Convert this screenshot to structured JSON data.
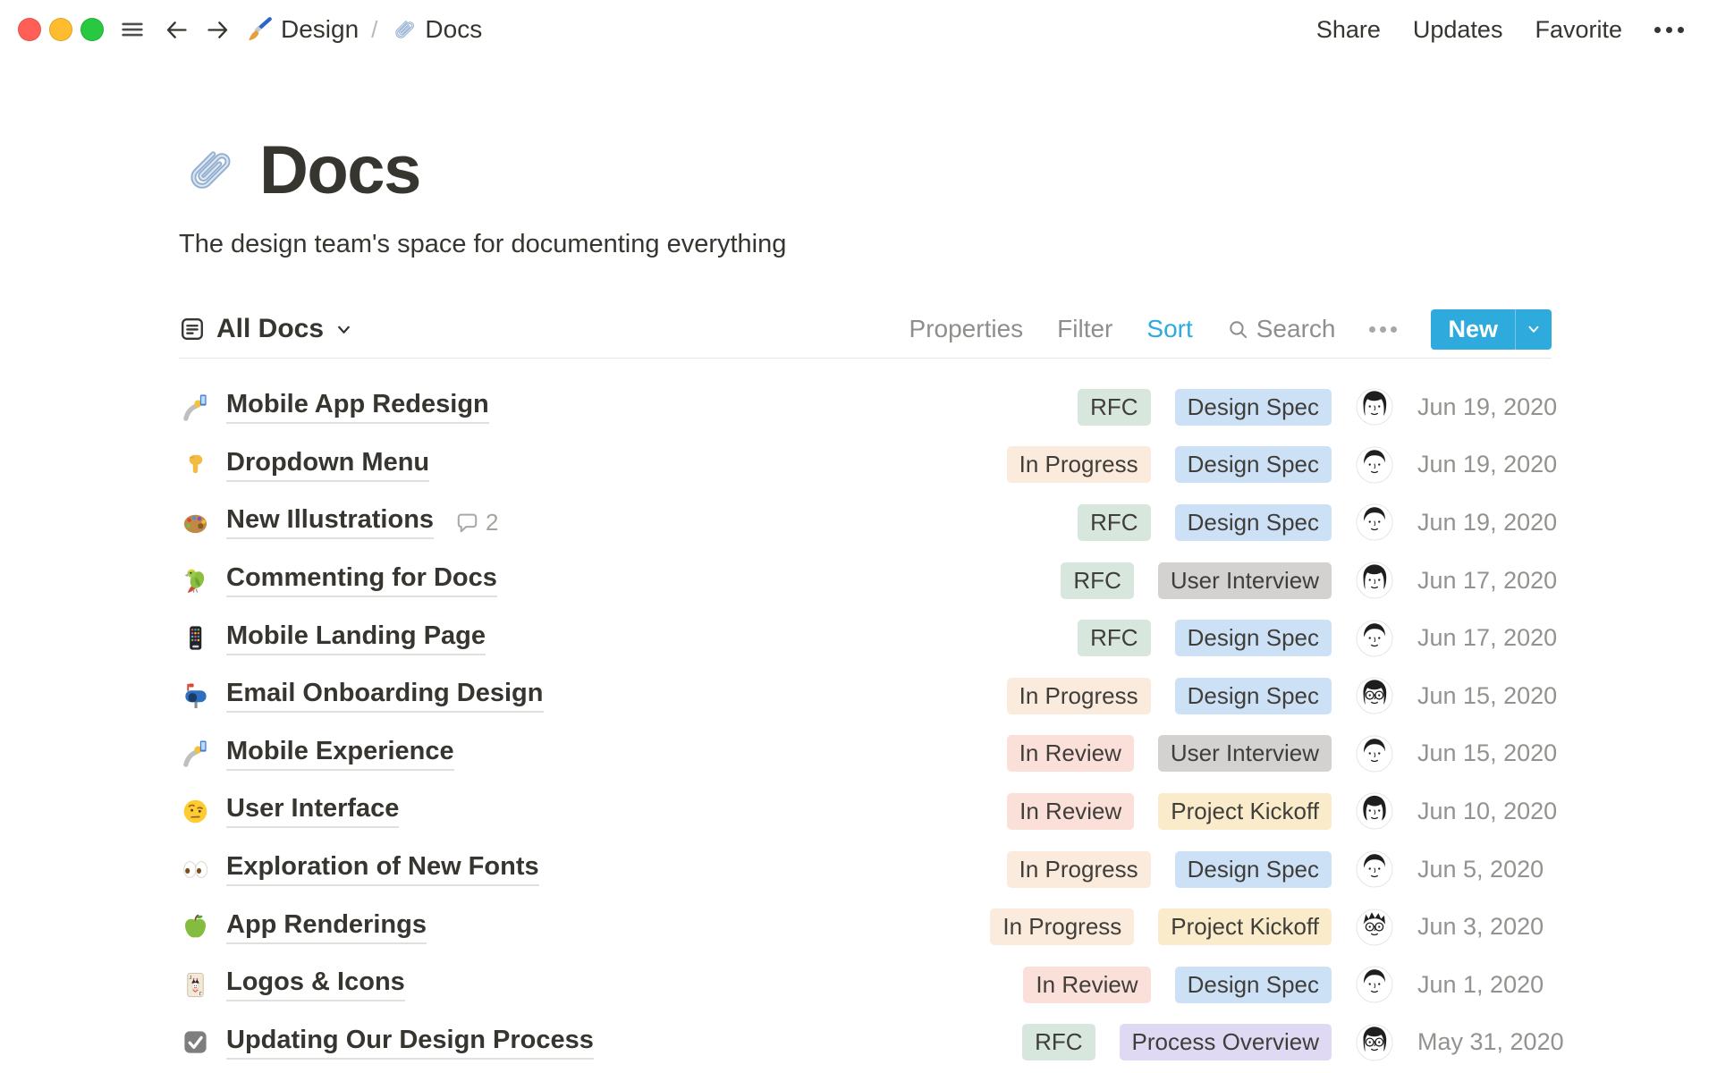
{
  "topbar": {
    "window_buttons": [
      "close",
      "minimize",
      "zoom"
    ],
    "breadcrumb": [
      {
        "icon": "paintbrush-icon",
        "label": "Design"
      },
      {
        "icon": "paperclip-icon",
        "label": "Docs"
      }
    ],
    "separator": "/",
    "actions": [
      "Share",
      "Updates",
      "Favorite"
    ],
    "more_icon": "ellipsis-icon"
  },
  "page": {
    "icon": "paperclip-icon",
    "title": "Docs",
    "subtitle": "The design team's space for documenting everything"
  },
  "toolbar": {
    "view_icon": "list-view-icon",
    "view_label": "All Docs",
    "properties_label": "Properties",
    "filter_label": "Filter",
    "sort_label": "Sort",
    "search_icon": "search-icon",
    "search_label": "Search",
    "more_icon": "ellipsis-icon",
    "new_label": "New",
    "new_chevron_icon": "chevron-down-icon"
  },
  "colors": {
    "accent": "#2EAADC",
    "sort_active": "#2EAADC",
    "traffic": {
      "close": "#FF5F57",
      "minimize": "#FEBC2E",
      "zoom": "#28C840"
    },
    "badge_text": "#403E3A",
    "badges": {
      "green": "#D7E7DD",
      "orange": "#FAEBDC",
      "red": "#FBE0DA",
      "blue": "#CDE1F6",
      "gray": "#D3D2D0",
      "yellow": "#FAECCA",
      "purple": "#E0D9F4"
    }
  },
  "table": {
    "rows": [
      {
        "icon": "selfie",
        "title": "Mobile App Redesign",
        "status": "RFC",
        "status_color": "green",
        "type": "Design Spec",
        "type_color": "blue",
        "avatar": "woman",
        "date": "Jun 19, 2020"
      },
      {
        "icon": "point-down",
        "title": "Dropdown Menu",
        "status": "In Progress",
        "status_color": "orange",
        "type": "Design Spec",
        "type_color": "blue",
        "avatar": "man",
        "date": "Jun 19, 2020"
      },
      {
        "icon": "palette",
        "title": "New Illustrations",
        "comments": "2",
        "status": "RFC",
        "status_color": "green",
        "type": "Design Spec",
        "type_color": "blue",
        "avatar": "man",
        "date": "Jun 19, 2020"
      },
      {
        "icon": "parrot",
        "title": "Commenting for Docs",
        "status": "RFC",
        "status_color": "green",
        "type": "User Interview",
        "type_color": "gray",
        "avatar": "woman",
        "date": "Jun 17, 2020"
      },
      {
        "icon": "phone",
        "title": "Mobile Landing Page",
        "status": "RFC",
        "status_color": "green",
        "type": "Design Spec",
        "type_color": "blue",
        "avatar": "man",
        "date": "Jun 17, 2020"
      },
      {
        "icon": "mailbox",
        "title": "Email Onboarding Design",
        "status": "In Progress",
        "status_color": "orange",
        "type": "Design Spec",
        "type_color": "blue",
        "avatar": "longhair-glasses",
        "date": "Jun 15, 2020"
      },
      {
        "icon": "selfie",
        "title": "Mobile Experience",
        "status": "In Review",
        "status_color": "red",
        "type": "User Interview",
        "type_color": "gray",
        "avatar": "man",
        "date": "Jun 15, 2020"
      },
      {
        "icon": "face-brow",
        "title": "User Interface",
        "status": "In Review",
        "status_color": "red",
        "type": "Project Kickoff",
        "type_color": "yellow",
        "avatar": "bob",
        "date": "Jun 10, 2020"
      },
      {
        "icon": "eyes",
        "title": "Exploration of New Fonts",
        "status": "In Progress",
        "status_color": "orange",
        "type": "Design Spec",
        "type_color": "blue",
        "avatar": "man",
        "date": "Jun 5, 2020"
      },
      {
        "icon": "apple",
        "title": "App Renderings",
        "status": "In Progress",
        "status_color": "orange",
        "type": "Project Kickoff",
        "type_color": "yellow",
        "avatar": "spiky-glasses",
        "date": "Jun 3, 2020"
      },
      {
        "icon": "joker",
        "title": "Logos & Icons",
        "status": "In Review",
        "status_color": "red",
        "type": "Design Spec",
        "type_color": "blue",
        "avatar": "man",
        "date": "Jun 1, 2020"
      },
      {
        "icon": "checkbox",
        "title": "Updating Our Design Process",
        "status": "RFC",
        "status_color": "green",
        "type": "Process Overview",
        "type_color": "purple",
        "avatar": "longhair-glasses",
        "date": "May 31, 2020"
      }
    ]
  }
}
